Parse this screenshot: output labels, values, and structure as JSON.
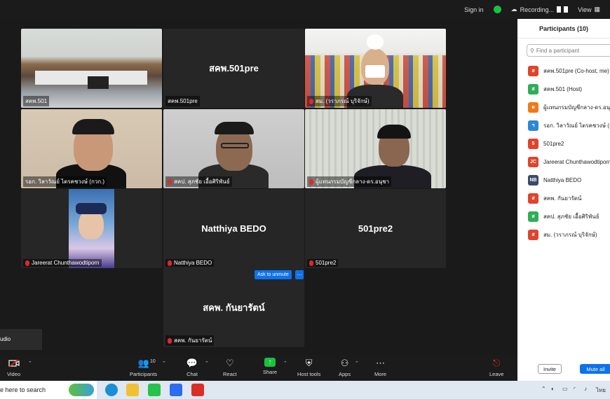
{
  "topbar": {
    "signin": "Sign in",
    "recording": "Recording...",
    "view": "View"
  },
  "tiles": [
    {
      "name": "สคพ.501",
      "big": ""
    },
    {
      "name": "สคพ.501pre",
      "big": "สคพ.501pre"
    },
    {
      "name": "สม. (วราภรณ์ บุริจักษ์)",
      "big": ""
    },
    {
      "name": "รอก. วิลาวัณย์ ไตรคชวงษ์ (กวก.)",
      "big": ""
    },
    {
      "name": "สคป. สุภชัย เอื้อศิริพันธ์",
      "big": ""
    },
    {
      "name": "ผู้แทนกรมบัญชีกลาง-ดร.อนุชา",
      "big": ""
    },
    {
      "name": "Jareerat Chunthawodtiporn",
      "big": ""
    },
    {
      "name": "Natthiya BEDO",
      "big": "Natthiya BEDO"
    },
    {
      "name": "501pre2",
      "big": "501pre2"
    }
  ],
  "hangout": {
    "name": "สคพ. กันยารัตน์",
    "big": "สคพ. กันยารัตน์",
    "unmute": "Ask to unmute",
    "dots": "···"
  },
  "audio": {
    "text": "udio"
  },
  "toolbar": {
    "video": "Video",
    "participants": "Participants",
    "participants_count": "10",
    "chat": "Chat",
    "react": "React",
    "share": "Share",
    "host_tools": "Host tools",
    "apps": "Apps",
    "more": "More",
    "leave": "Leave"
  },
  "panel": {
    "title": "Participants (10)",
    "search_placeholder": "Find a participant",
    "participants": [
      {
        "initial": "ส",
        "color": "#e0442b",
        "name": "สคพ.501pre (Co-host, me)"
      },
      {
        "initial": "ส",
        "color": "#2fae58",
        "name": "สคพ.501 (Host)"
      },
      {
        "initial": "ผ",
        "color": "#ef7a17",
        "name": "ผู้แทนกรมบัญชีกลาง-ดร.อนุชา"
      },
      {
        "initial": "ฯ",
        "color": "#2d87d6",
        "name": "รอก. วิลาวัณย์ ไตรคชวงษ์ (กวก.)"
      },
      {
        "initial": "5",
        "color": "#e0442b",
        "name": "501pre2"
      },
      {
        "initial": "JC",
        "color": "#e0442b",
        "name": "Jareerat Chunthawodtiporn"
      },
      {
        "initial": "NB",
        "color": "#3b4a6b",
        "name": "Natthiya BEDO"
      },
      {
        "initial": "ส",
        "color": "#e0442b",
        "name": "สคพ. กันยารัตน์"
      },
      {
        "initial": "ส",
        "color": "#2fae58",
        "name": "สคป. สุภชัย เอื้อศิริพันธ์"
      },
      {
        "initial": "ส",
        "color": "#e0442b",
        "name": "สม. (วราภรณ์ บุริจักษ์)"
      }
    ],
    "invite": "Invite",
    "mute_all": "Mute all"
  },
  "taskbar": {
    "search_text": "e here to search",
    "lang": "ไทย"
  }
}
